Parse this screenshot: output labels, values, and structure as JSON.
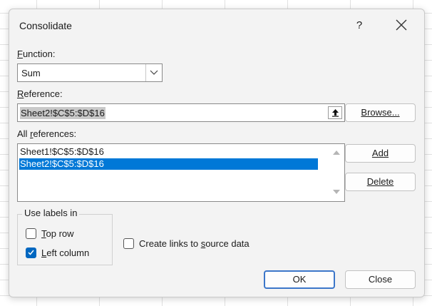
{
  "dialog": {
    "title": "Consolidate",
    "help_label": "?"
  },
  "function": {
    "label_prefix": "",
    "label_mnemonic": "F",
    "label_rest": "unction:",
    "selected": "Sum"
  },
  "reference": {
    "label_mnemonic": "R",
    "label_rest": "eference:",
    "value": "Sheet2!$C$5:$D$16",
    "browse_label": "Browse..."
  },
  "all_references": {
    "label_pre": "All ",
    "label_mnemonic": "r",
    "label_rest": "eferences:",
    "items": [
      "Sheet1!$C$5:$D$16",
      "Sheet2!$C$5:$D$16"
    ],
    "selected_index": 1,
    "add_label": "Add",
    "delete_label": "Delete"
  },
  "use_labels": {
    "title": "Use labels in",
    "top_row": {
      "mnemonic": "T",
      "rest": "op row",
      "checked": false
    },
    "left_column": {
      "mnemonic": "L",
      "rest": "eft column",
      "checked": true
    }
  },
  "create_links": {
    "pre": "Create links to ",
    "mnemonic": "s",
    "rest": "ource data",
    "checked": false
  },
  "footer": {
    "ok_label": "OK",
    "close_label": "Close"
  },
  "colors": {
    "accent": "#0067c0",
    "selection": "#0078d7",
    "dialog_bg": "#f3f3f3"
  }
}
